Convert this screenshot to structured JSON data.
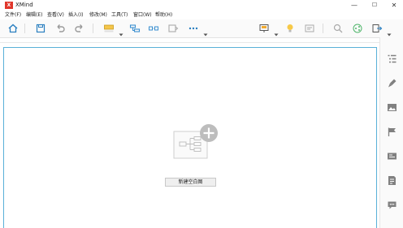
{
  "window": {
    "title": "XMind",
    "logo_text": "X",
    "minimize": "—",
    "maximize": "☐",
    "close": "✕"
  },
  "menu": [
    {
      "label": "文件(F)"
    },
    {
      "label": "编辑(E)"
    },
    {
      "label": "查看(V)"
    },
    {
      "label": "插入(I)"
    },
    {
      "label": "修改(M)"
    },
    {
      "label": "工具(T)"
    },
    {
      "label": "窗口(W)"
    },
    {
      "label": "帮助(H)"
    }
  ],
  "toolbar": {
    "icons": [
      "home-icon",
      "save-icon",
      "undo-icon",
      "redo-icon",
      "topic-style-icon",
      "subtopic-icon",
      "relationship-icon",
      "boundary-icon",
      "more-icon",
      "presentation-icon",
      "idea-icon",
      "outline-icon",
      "search-icon",
      "share-icon",
      "export-icon"
    ]
  },
  "sidebar": {
    "icons": [
      "outline-icon",
      "format-brush-icon",
      "image-icon",
      "marker-flag-icon",
      "library-icon",
      "notes-icon",
      "comments-icon"
    ]
  },
  "canvas": {
    "new_blank_map_label": "新建空白图"
  },
  "colors": {
    "accent": "#59b0d8",
    "brand": "#e0362b"
  }
}
